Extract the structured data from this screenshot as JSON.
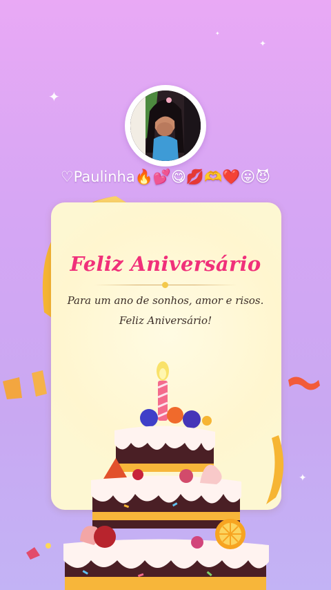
{
  "profile": {
    "username": "♡Paulinha🔥💕😋💋🫶❤️😛😈"
  },
  "card": {
    "title": "Feliz Aniversário",
    "message_line1": "Para um ano de sonhos, amor e risos.",
    "message_line2": "Feliz Aniversário!"
  },
  "colors": {
    "background_top": "#e9a9f5",
    "background_bottom": "#c3b3f5",
    "card": "#fdf7d2",
    "title": "#f0307a",
    "ribbon": "#f6b533"
  },
  "icons": [
    "sparkle-icon",
    "birthday-cake-icon",
    "candle-icon",
    "confetti-icon",
    "ribbon-icon"
  ]
}
